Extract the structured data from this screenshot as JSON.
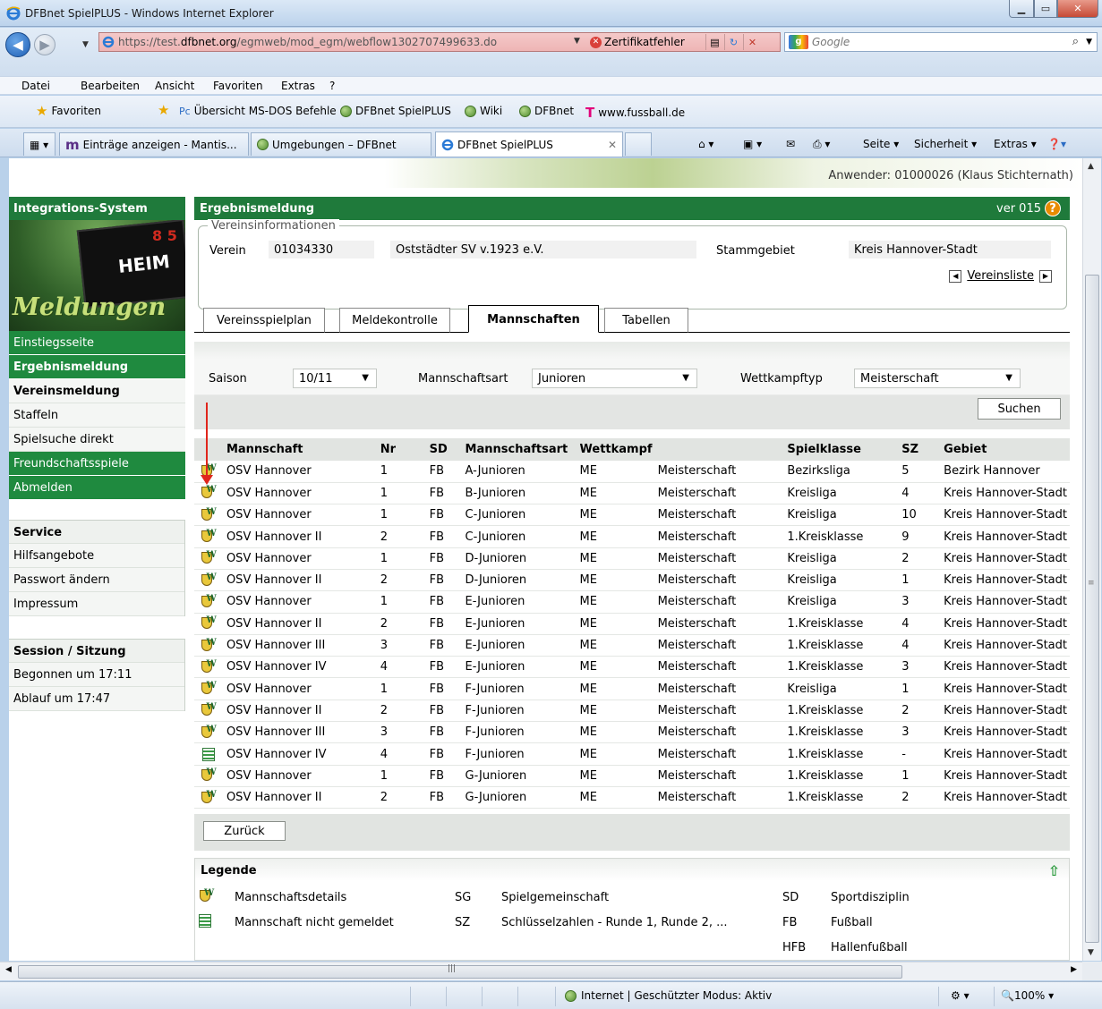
{
  "window": {
    "title": "DFBnet SpielPLUS - Windows Internet Explorer"
  },
  "address": {
    "url_prefix": "https://test.",
    "url_domain": "dfbnet.org",
    "url_path": "/egmweb/mod_egm/webflow1302707499633.do",
    "cert_error": "Zertifikatfehler",
    "search_placeholder": "Google"
  },
  "menu": [
    "Datei",
    "Bearbeiten",
    "Ansicht",
    "Favoriten",
    "Extras",
    "?"
  ],
  "favorites": {
    "label": "Favoriten",
    "links": [
      "Übersicht MS-DOS Befehle",
      "DFBnet SpielPLUS",
      "Wiki",
      "DFBnet",
      "www.fussball.de"
    ]
  },
  "tabs": {
    "items": [
      "Einträge anzeigen - Mantis...",
      "Umgebungen – DFBnet",
      "DFBnet SpielPLUS"
    ],
    "tools": [
      "Seite ▾",
      "Sicherheit ▾",
      "Extras ▾"
    ]
  },
  "status": {
    "zone": "Internet | Geschützter Modus: Aktiv",
    "zoom": "100%"
  },
  "page": {
    "user": "Anwender: 01000026 (Klaus Stichternath)",
    "side": {
      "head": "Integrations-System",
      "pic_heim": "HEIM",
      "pic_meld": "Meldungen",
      "items": [
        "Einstiegsseite",
        "Ergebnismeldung",
        "Vereinsmeldung",
        "Staffeln",
        "Spielsuche direkt",
        "Freundschaftsspiele",
        "Abmelden"
      ],
      "service_head": "Service",
      "service_items": [
        "Hilfsangebote",
        "Passwort ändern",
        "Impressum"
      ],
      "session_head": "Session / Sitzung",
      "session_items": [
        "Begonnen um 17:11",
        "Ablauf um 17:47"
      ]
    },
    "main": {
      "title": "Ergebnismeldung",
      "version": "ver 015",
      "verein": {
        "legend": "Vereinsinformationen",
        "label_verein": "Verein",
        "number": "01034330",
        "name": "Oststädter SV v.1923 e.V.",
        "label_stammgebiet": "Stammgebiet",
        "stammgebiet": "Kreis Hannover-Stadt",
        "list_link": "Vereinsliste"
      },
      "tabs": [
        "Vereinsspielplan",
        "Meldekontrolle",
        "Mannschaften",
        "Tabellen"
      ],
      "filter": {
        "saison_label": "Saison",
        "saison_value": "10/11",
        "art_label": "Mannschaftsart",
        "art_value": "Junioren",
        "typ_label": "Wettkampftyp",
        "typ_value": "Meisterschaft",
        "search_button": "Suchen"
      },
      "table": {
        "headers": [
          "Mannschaft",
          "Nr",
          "SD",
          "Mannschaftsart",
          "Wettkampf",
          "",
          "Spielklasse",
          "SZ",
          "Gebiet"
        ],
        "rows": [
          {
            "icon": "details",
            "cells": [
              "OSV Hannover",
              "1",
              "FB",
              "A-Junioren",
              "ME",
              "Meisterschaft",
              "Bezirksliga",
              "5",
              "Bezirk Hannover"
            ]
          },
          {
            "icon": "details",
            "cells": [
              "OSV Hannover",
              "1",
              "FB",
              "B-Junioren",
              "ME",
              "Meisterschaft",
              "Kreisliga",
              "4",
              "Kreis Hannover-Stadt"
            ]
          },
          {
            "icon": "details",
            "cells": [
              "OSV Hannover",
              "1",
              "FB",
              "C-Junioren",
              "ME",
              "Meisterschaft",
              "Kreisliga",
              "10",
              "Kreis Hannover-Stadt"
            ]
          },
          {
            "icon": "details",
            "cells": [
              "OSV Hannover II",
              "2",
              "FB",
              "C-Junioren",
              "ME",
              "Meisterschaft",
              "1.Kreisklasse",
              "9",
              "Kreis Hannover-Stadt"
            ]
          },
          {
            "icon": "details",
            "cells": [
              "OSV Hannover",
              "1",
              "FB",
              "D-Junioren",
              "ME",
              "Meisterschaft",
              "Kreisliga",
              "2",
              "Kreis Hannover-Stadt"
            ]
          },
          {
            "icon": "details",
            "cells": [
              "OSV Hannover II",
              "2",
              "FB",
              "D-Junioren",
              "ME",
              "Meisterschaft",
              "Kreisliga",
              "1",
              "Kreis Hannover-Stadt"
            ]
          },
          {
            "icon": "details",
            "cells": [
              "OSV Hannover",
              "1",
              "FB",
              "E-Junioren",
              "ME",
              "Meisterschaft",
              "Kreisliga",
              "3",
              "Kreis Hannover-Stadt"
            ]
          },
          {
            "icon": "details",
            "cells": [
              "OSV Hannover II",
              "2",
              "FB",
              "E-Junioren",
              "ME",
              "Meisterschaft",
              "1.Kreisklasse",
              "4",
              "Kreis Hannover-Stadt"
            ]
          },
          {
            "icon": "details",
            "cells": [
              "OSV Hannover III",
              "3",
              "FB",
              "E-Junioren",
              "ME",
              "Meisterschaft",
              "1.Kreisklasse",
              "4",
              "Kreis Hannover-Stadt"
            ]
          },
          {
            "icon": "details",
            "cells": [
              "OSV Hannover IV",
              "4",
              "FB",
              "E-Junioren",
              "ME",
              "Meisterschaft",
              "1.Kreisklasse",
              "3",
              "Kreis Hannover-Stadt"
            ]
          },
          {
            "icon": "details",
            "cells": [
              "OSV Hannover",
              "1",
              "FB",
              "F-Junioren",
              "ME",
              "Meisterschaft",
              "Kreisliga",
              "1",
              "Kreis Hannover-Stadt"
            ]
          },
          {
            "icon": "details",
            "cells": [
              "OSV Hannover II",
              "2",
              "FB",
              "F-Junioren",
              "ME",
              "Meisterschaft",
              "1.Kreisklasse",
              "2",
              "Kreis Hannover-Stadt"
            ]
          },
          {
            "icon": "details",
            "cells": [
              "OSV Hannover III",
              "3",
              "FB",
              "F-Junioren",
              "ME",
              "Meisterschaft",
              "1.Kreisklasse",
              "3",
              "Kreis Hannover-Stadt"
            ]
          },
          {
            "icon": "notreg",
            "cells": [
              "OSV Hannover IV",
              "4",
              "FB",
              "F-Junioren",
              "ME",
              "Meisterschaft",
              "1.Kreisklasse",
              "-",
              "Kreis Hannover-Stadt"
            ]
          },
          {
            "icon": "details",
            "cells": [
              "OSV Hannover",
              "1",
              "FB",
              "G-Junioren",
              "ME",
              "Meisterschaft",
              "1.Kreisklasse",
              "1",
              "Kreis Hannover-Stadt"
            ]
          },
          {
            "icon": "details",
            "cells": [
              "OSV Hannover II",
              "2",
              "FB",
              "G-Junioren",
              "ME",
              "Meisterschaft",
              "1.Kreisklasse",
              "2",
              "Kreis Hannover-Stadt"
            ]
          }
        ]
      },
      "back_button": "Zurück",
      "legend": {
        "title": "Legende",
        "details": "Mannschaftsdetails",
        "notreg": "Mannschaft nicht gemeldet",
        "sg": "SG",
        "sg_text": "Spielgemeinschaft",
        "sz": "SZ",
        "sz_text": "Schlüsselzahlen - Runde 1, Runde 2, ...",
        "sd": "SD",
        "sd_text": "Sportdisziplin",
        "fb": "FB",
        "fb_text": "Fußball",
        "hfb": "HFB",
        "hfb_text": "Hallenfußball"
      }
    }
  }
}
